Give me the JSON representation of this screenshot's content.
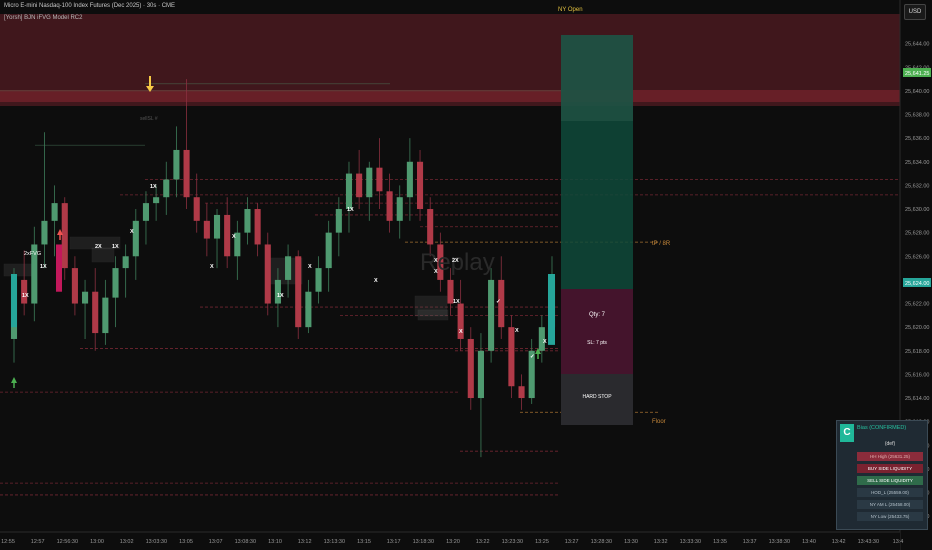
{
  "header": {
    "title": "Micro E-mini Nasdaq-100 Index Futures (Dec 2025) · 30s · CME",
    "indicator": "[Yorsh] BJN iFVG Model RC2",
    "currency": "USD"
  },
  "session_label": "NY Open",
  "watermark": "Replay",
  "price_axis": {
    "ticks": [
      "25,644.00",
      "25,642.00",
      "25,640.00",
      "25,638.00",
      "25,636.00",
      "25,634.00",
      "25,632.00",
      "25,630.00",
      "25,628.00",
      "25,626.00",
      "25,624.00",
      "25,622.00",
      "25,620.00",
      "25,618.00",
      "25,616.00",
      "25,614.00",
      "25,612.00",
      "25,610.00",
      "25,608.00",
      "25,606.00",
      "25,604.00"
    ],
    "highlight_top": {
      "label": "25,641.25",
      "value": 25641.25,
      "color": "#4caf50"
    },
    "highlight_current": {
      "label": "25,624.00",
      "value": 25624.0,
      "color": "#26a69a"
    }
  },
  "time_axis": {
    "ticks": [
      "12:55",
      "12:57",
      "12:56:30",
      "13:00",
      "13:02",
      "13:03:30",
      "13:05",
      "13:07",
      "13:08:30",
      "13:10",
      "13:12",
      "13:13:30",
      "13:15",
      "13:17",
      "13:18:30",
      "13:20",
      "13:22",
      "13:23:30",
      "13:25",
      "13:27",
      "13:28:30",
      "13:30",
      "13:32",
      "13:33:30",
      "13:35",
      "13:37",
      "13:38:30",
      "13:40",
      "13:42",
      "13:43:30",
      "13:4"
    ]
  },
  "chart_labels": {
    "fvg": "2xFVG",
    "markers": [
      "1X",
      "1X",
      "1X",
      "2X",
      "X",
      "X",
      "X",
      "1X",
      "X",
      "1X",
      "1X",
      "X",
      "X",
      "X",
      "2X",
      "X",
      "1X",
      "X",
      "X",
      "✓",
      "✓"
    ],
    "tp": "tP / 8R",
    "floor": "Floor",
    "faint_top": "sellSL #"
  },
  "trade_box": {
    "qty": "Qty: 7",
    "sl": "SL: 7 pts",
    "hard_stop": "HARD STOP"
  },
  "dashboard": {
    "badge": "C",
    "title": "Bias (CONFIRMED)",
    "subtitle": "(def)",
    "rows": [
      {
        "label": "HH High (25631.25)",
        "color": "#8b2c3b",
        "text_color": "#e0b0b0"
      },
      {
        "label": "BUY SIDE LIQUIDITY",
        "color": "#7a2230",
        "text_color": "#ffffff"
      },
      {
        "label": "SELL SIDE LIQUIDITY",
        "color": "#2f6b4a",
        "text_color": "#ffffff"
      },
      {
        "label": "HOD_L (25559.00)",
        "color": "#2a3944",
        "text_color": "#b6c3cc"
      },
      {
        "label": "NY AM L (25458.00)",
        "color": "#2a3944",
        "text_color": "#b6c3cc"
      },
      {
        "label": "NY Low (25433.75)",
        "color": "#2a3944",
        "text_color": "#b6c3cc"
      }
    ]
  },
  "colors": {
    "bull": "#26a69a",
    "bear": "#ef5350",
    "bull_body": "#4f9a70",
    "bear_body": "#b03a48",
    "zone": "#5a1e24",
    "target": "#0f4a3b",
    "stop": "#4a1530"
  },
  "chart_data": {
    "type": "candlestick",
    "y_min": 25603,
    "y_max": 25646,
    "candles": [
      {
        "o": 25619.0,
        "h": 25625.0,
        "l": 25617.0,
        "c": 25624.0
      },
      {
        "o": 25624.0,
        "h": 25626.5,
        "l": 25621.0,
        "c": 25622.0
      },
      {
        "o": 25622.0,
        "h": 25628.5,
        "l": 25620.5,
        "c": 25627.0
      },
      {
        "o": 25627.0,
        "h": 25636.5,
        "l": 25625.0,
        "c": 25629.0
      },
      {
        "o": 25629.0,
        "h": 25632.0,
        "l": 25626.0,
        "c": 25630.5
      },
      {
        "o": 25630.5,
        "h": 25631.0,
        "l": 25624.0,
        "c": 25625.0
      },
      {
        "o": 25625.0,
        "h": 25626.0,
        "l": 25621.0,
        "c": 25622.0
      },
      {
        "o": 25622.0,
        "h": 25624.0,
        "l": 25619.0,
        "c": 25623.0
      },
      {
        "o": 25623.0,
        "h": 25625.0,
        "l": 25618.0,
        "c": 25619.5
      },
      {
        "o": 25619.5,
        "h": 25624.0,
        "l": 25618.5,
        "c": 25622.5
      },
      {
        "o": 25622.5,
        "h": 25626.0,
        "l": 25620.0,
        "c": 25625.0
      },
      {
        "o": 25625.0,
        "h": 25627.0,
        "l": 25622.5,
        "c": 25626.0
      },
      {
        "o": 25626.0,
        "h": 25630.0,
        "l": 25624.0,
        "c": 25629.0
      },
      {
        "o": 25629.0,
        "h": 25631.5,
        "l": 25627.0,
        "c": 25630.5
      },
      {
        "o": 25630.5,
        "h": 25632.0,
        "l": 25629.0,
        "c": 25631.0
      },
      {
        "o": 25631.0,
        "h": 25634.0,
        "l": 25629.5,
        "c": 25632.5
      },
      {
        "o": 25632.5,
        "h": 25637.0,
        "l": 25631.0,
        "c": 25635.0
      },
      {
        "o": 25635.0,
        "h": 25641.0,
        "l": 25630.0,
        "c": 25631.0
      },
      {
        "o": 25631.0,
        "h": 25633.0,
        "l": 25628.0,
        "c": 25629.0
      },
      {
        "o": 25629.0,
        "h": 25630.5,
        "l": 25626.0,
        "c": 25627.5
      },
      {
        "o": 25627.5,
        "h": 25630.0,
        "l": 25625.0,
        "c": 25629.5
      },
      {
        "o": 25629.5,
        "h": 25631.0,
        "l": 25625.0,
        "c": 25626.0
      },
      {
        "o": 25626.0,
        "h": 25629.0,
        "l": 25624.0,
        "c": 25628.0
      },
      {
        "o": 25628.0,
        "h": 25631.0,
        "l": 25627.0,
        "c": 25630.0
      },
      {
        "o": 25630.0,
        "h": 25630.5,
        "l": 25626.0,
        "c": 25627.0
      },
      {
        "o": 25627.0,
        "h": 25628.0,
        "l": 25621.0,
        "c": 25622.0
      },
      {
        "o": 25622.0,
        "h": 25625.0,
        "l": 25620.0,
        "c": 25624.0
      },
      {
        "o": 25624.0,
        "h": 25627.0,
        "l": 25622.5,
        "c": 25626.0
      },
      {
        "o": 25626.0,
        "h": 25626.5,
        "l": 25619.0,
        "c": 25620.0
      },
      {
        "o": 25620.0,
        "h": 25624.0,
        "l": 25619.5,
        "c": 25623.0
      },
      {
        "o": 25623.0,
        "h": 25626.0,
        "l": 25622.0,
        "c": 25625.0
      },
      {
        "o": 25625.0,
        "h": 25629.0,
        "l": 25623.0,
        "c": 25628.0
      },
      {
        "o": 25628.0,
        "h": 25631.0,
        "l": 25626.0,
        "c": 25630.0
      },
      {
        "o": 25630.0,
        "h": 25634.0,
        "l": 25628.0,
        "c": 25633.0
      },
      {
        "o": 25633.0,
        "h": 25635.0,
        "l": 25630.0,
        "c": 25631.0
      },
      {
        "o": 25631.0,
        "h": 25634.0,
        "l": 25629.0,
        "c": 25633.5
      },
      {
        "o": 25633.5,
        "h": 25636.0,
        "l": 25630.0,
        "c": 25631.5
      },
      {
        "o": 25631.5,
        "h": 25633.0,
        "l": 25628.0,
        "c": 25629.0
      },
      {
        "o": 25629.0,
        "h": 25632.0,
        "l": 25627.5,
        "c": 25631.0
      },
      {
        "o": 25631.0,
        "h": 25636.0,
        "l": 25629.0,
        "c": 25634.0
      },
      {
        "o": 25634.0,
        "h": 25635.0,
        "l": 25629.0,
        "c": 25630.0
      },
      {
        "o": 25630.0,
        "h": 25631.0,
        "l": 25626.0,
        "c": 25627.0
      },
      {
        "o": 25627.0,
        "h": 25628.0,
        "l": 25623.0,
        "c": 25624.0
      },
      {
        "o": 25624.0,
        "h": 25625.0,
        "l": 25621.0,
        "c": 25622.0
      },
      {
        "o": 25622.0,
        "h": 25624.0,
        "l": 25618.0,
        "c": 25619.0
      },
      {
        "o": 25619.0,
        "h": 25620.0,
        "l": 25613.0,
        "c": 25614.0
      },
      {
        "o": 25614.0,
        "h": 25619.5,
        "l": 25609.0,
        "c": 25618.0
      },
      {
        "o": 25618.0,
        "h": 25625.0,
        "l": 25617.0,
        "c": 25624.0
      },
      {
        "o": 25624.0,
        "h": 25626.0,
        "l": 25619.0,
        "c": 25620.0
      },
      {
        "o": 25620.0,
        "h": 25621.0,
        "l": 25614.0,
        "c": 25615.0
      },
      {
        "o": 25615.0,
        "h": 25616.0,
        "l": 25613.0,
        "c": 25614.0
      },
      {
        "o": 25614.0,
        "h": 25619.0,
        "l": 25613.5,
        "c": 25618.0
      },
      {
        "o": 25618.0,
        "h": 25621.0,
        "l": 25617.0,
        "c": 25620.0
      },
      {
        "o": 25620.0,
        "h": 25626.0,
        "l": 25619.5,
        "c": 25624.0
      }
    ]
  }
}
